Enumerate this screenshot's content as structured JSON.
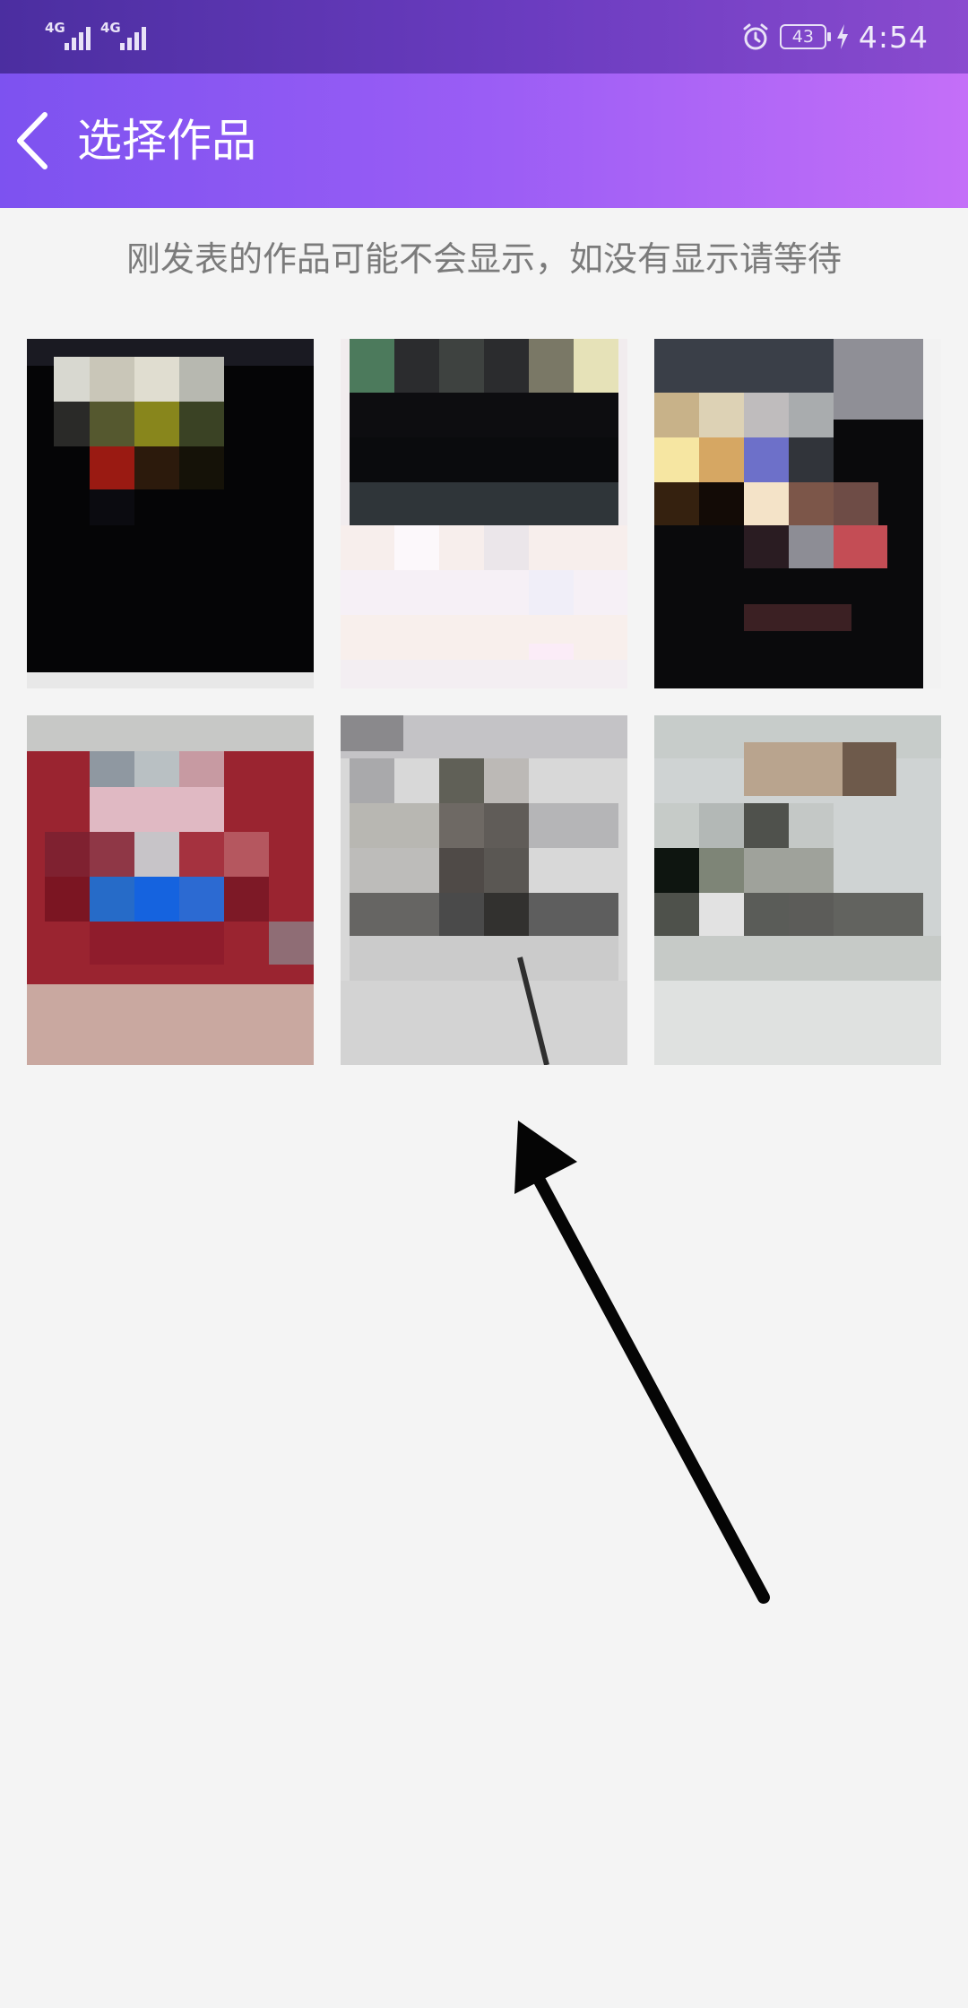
{
  "status_bar": {
    "signal_1_label": "4G",
    "signal_2_label": "4G",
    "battery_level": "43",
    "time": "4:54"
  },
  "header": {
    "title": "选择作品",
    "back_icon": "chevron-left-icon"
  },
  "notice": "刚发表的作品可能不会显示，如没有显示请等待",
  "thumbnails_count": 6,
  "colors": {
    "header_start": "#7d52f0",
    "header_end": "#c46ff8",
    "background": "#f4f4f4",
    "notice_text": "#7b7b7b"
  }
}
